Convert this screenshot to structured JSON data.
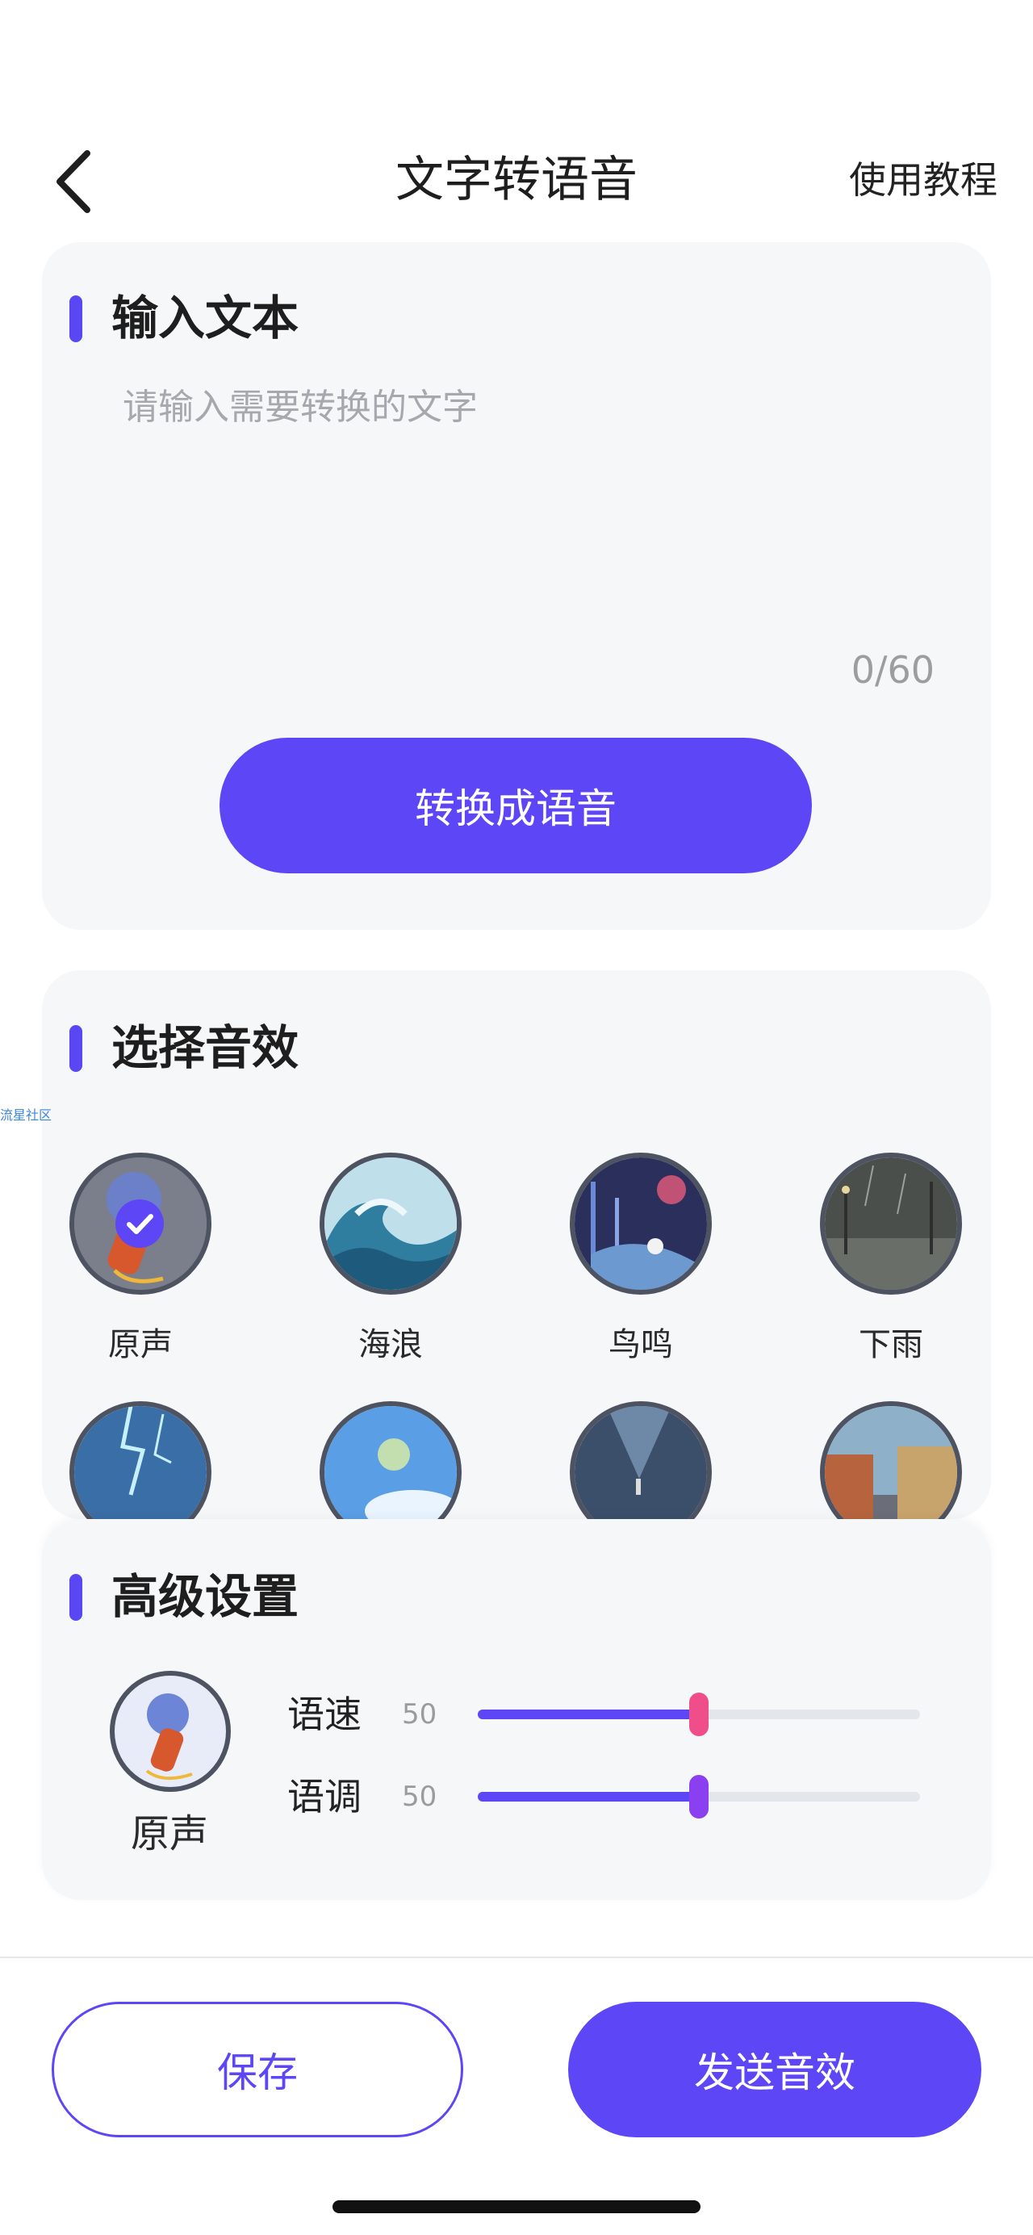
{
  "header": {
    "title": "文字转语音",
    "tutorial_label": "使用教程"
  },
  "input_section": {
    "title": "输入文本",
    "placeholder": "请输入需要转换的文字",
    "value": "",
    "counter": "0/60",
    "convert_label": "转换成语音"
  },
  "effects_section": {
    "title": "选择音效",
    "selected": "原声",
    "effects": [
      {
        "label": "原声",
        "icon": "microphone-icon"
      },
      {
        "label": "海浪",
        "icon": "wave-image"
      },
      {
        "label": "鸟鸣",
        "icon": "bird-image"
      },
      {
        "label": "下雨",
        "icon": "rain-image"
      },
      {
        "label": "",
        "icon": "lightning-image"
      },
      {
        "label": "",
        "icon": "sky-image"
      },
      {
        "label": "",
        "icon": "cave-image"
      },
      {
        "label": "",
        "icon": "street-image"
      }
    ]
  },
  "advanced_section": {
    "title": "高级设置",
    "voice_label": "原声",
    "speed": {
      "label": "语速",
      "value": "50",
      "fraction": 0.5
    },
    "pitch": {
      "label": "语调",
      "value": "50",
      "fraction": 0.5
    }
  },
  "footer": {
    "save_label": "保存",
    "send_label": "发送音效"
  },
  "watermark": "流星社区",
  "colors": {
    "accent": "#5d46f5",
    "speed_thumb": "#f04e8a",
    "pitch_thumb": "#8a3ff0",
    "card_bg": "#f6f7f9"
  }
}
